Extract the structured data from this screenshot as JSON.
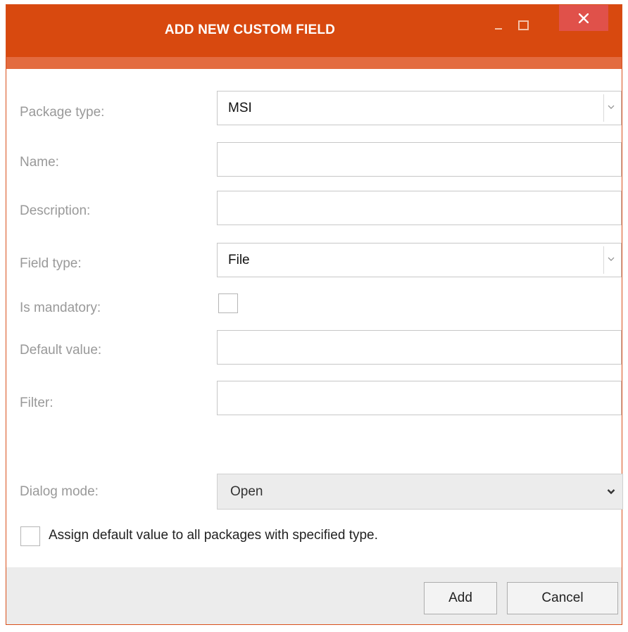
{
  "window": {
    "title": "ADD NEW CUSTOM FIELD",
    "controls": [
      "minimize-icon",
      "maximize-icon",
      "close-icon"
    ]
  },
  "colors": {
    "titlebar": "#d8490f",
    "accent_strip": "#e36b3f",
    "close_button": "#e0514a",
    "label_text": "#999999",
    "footer": "#ececec"
  },
  "form": {
    "package_type": {
      "label": "Package type:",
      "value": "MSI"
    },
    "name": {
      "label": "Name:",
      "value": ""
    },
    "description": {
      "label": "Description:",
      "value": ""
    },
    "field_type": {
      "label": "Field type:",
      "value": "File"
    },
    "is_mandatory": {
      "label": "Is mandatory:",
      "checked": false
    },
    "default_value": {
      "label": "Default value:",
      "value": ""
    },
    "filter": {
      "label": "Filter:",
      "value": ""
    },
    "dialog_mode": {
      "label": "Dialog mode:",
      "value": "Open"
    },
    "assign_default": {
      "label": "Assign default value to all packages with specified type.",
      "checked": false
    }
  },
  "footer": {
    "add_label": "Add",
    "cancel_label": "Cancel"
  }
}
